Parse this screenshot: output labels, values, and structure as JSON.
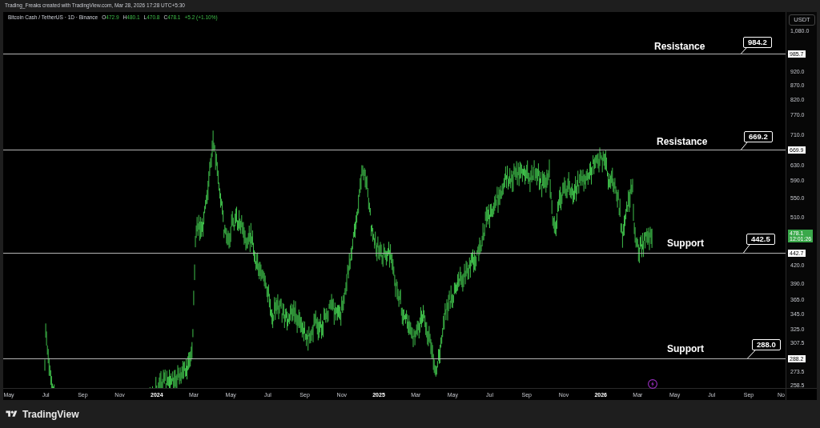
{
  "attribution": "Trading_Freaks created with TradingView.com, Mar 28, 2026 17:28 UTC+5:30",
  "symbol": {
    "title": "Bitcoin Cash / TetherUS · 1D · Binance",
    "ohlc": [
      {
        "label": "O",
        "value": "472.9"
      },
      {
        "label": "H",
        "value": "480.1"
      },
      {
        "label": "L",
        "value": "470.8"
      },
      {
        "label": "C",
        "value": "478.1"
      }
    ],
    "change": "+5.2 (+1.10%)"
  },
  "levels": [
    {
      "label": "Resistance",
      "callout": "984.2",
      "axis_label": "985.7"
    },
    {
      "label": "Resistance",
      "callout": "669.2",
      "axis_label": "669.9"
    },
    {
      "label": "Support",
      "callout": "442.5",
      "axis_label": "442.7"
    },
    {
      "label": "Support",
      "callout": "288.0",
      "axis_label": "288.2"
    }
  ],
  "price_axis": {
    "unit": "USDT",
    "ticks": [
      "1,080.0",
      "920.0",
      "870.0",
      "820.0",
      "770.0",
      "710.0",
      "630.0",
      "590.0",
      "550.0",
      "510.0",
      "420.0",
      "390.0",
      "365.0",
      "345.0",
      "325.0",
      "307.5",
      "273.5",
      "258.5"
    ],
    "current_price": {
      "value": "478.1",
      "countdown": "12:01:26"
    }
  },
  "time_axis": {
    "ticks": [
      {
        "label": "May",
        "kind": "month"
      },
      {
        "label": "Jul",
        "kind": "month"
      },
      {
        "label": "Sep",
        "kind": "month"
      },
      {
        "label": "Nov",
        "kind": "month"
      },
      {
        "label": "2024",
        "kind": "year"
      },
      {
        "label": "Mar",
        "kind": "month"
      },
      {
        "label": "May",
        "kind": "month"
      },
      {
        "label": "Jul",
        "kind": "month"
      },
      {
        "label": "Sep",
        "kind": "month"
      },
      {
        "label": "Nov",
        "kind": "month"
      },
      {
        "label": "2025",
        "kind": "year"
      },
      {
        "label": "Mar",
        "kind": "month"
      },
      {
        "label": "May",
        "kind": "month"
      },
      {
        "label": "Jul",
        "kind": "month"
      },
      {
        "label": "Sep",
        "kind": "month"
      },
      {
        "label": "Nov",
        "kind": "month"
      },
      {
        "label": "2026",
        "kind": "year"
      },
      {
        "label": "Mar",
        "kind": "month"
      },
      {
        "label": "May",
        "kind": "month"
      },
      {
        "label": "Jul",
        "kind": "month"
      },
      {
        "label": "Sep",
        "kind": "month"
      },
      {
        "label": "No",
        "kind": "month"
      }
    ]
  },
  "footer": {
    "brand": "TradingView"
  }
}
